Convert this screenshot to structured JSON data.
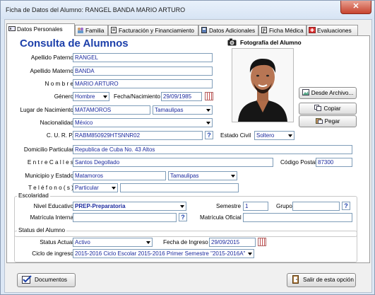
{
  "window": {
    "title": "Ficha de Datos del Alumno: RANGEL BANDA MARIO ARTURO",
    "close_label": "✕"
  },
  "tabs": [
    {
      "label": "Datos Personales",
      "icon": "id-card-icon"
    },
    {
      "label": "Familia",
      "icon": "family-icon"
    },
    {
      "label": "Facturación y Financiamiento",
      "icon": "invoice-icon"
    },
    {
      "label": "Datos Adicionales",
      "icon": "notebook-icon"
    },
    {
      "label": "Ficha Médica",
      "icon": "medical-record-icon"
    },
    {
      "label": "Evaluaciones",
      "icon": "evaluations-icon"
    }
  ],
  "heading": "Consulta de Alumnos",
  "photo": {
    "label": "Fotografía del Alumno",
    "from_file_label": "Desde Archivo...",
    "copy_label": "Copiar",
    "paste_label": "Pegar"
  },
  "labels": {
    "apellido_paterno": "Apellido Paterno",
    "apellido_materno": "Apellido Materno",
    "nombre": "N o m b r e",
    "genero": "Género",
    "fecha_nacimiento": "Fecha/Nacimiento",
    "lugar_nacimiento": "Lugar de Nacimiento",
    "nacionalidad": "Nacionalidad",
    "curp": "C. U. R. P.",
    "estado_civil": "Estado Civil",
    "domicilio": "Domicilio Particular",
    "calles": "E n t r e  C a l l e s",
    "codigo_postal": "Código Postal",
    "municipio": "Municipio y Estado",
    "telefono": "T e l é f o n o  ( s )",
    "escolaridad": "Escolaridad",
    "nivel": "Nivel Educativo",
    "semestre": "Semestre",
    "grupo": "Grupo",
    "matricula_interna": "Matrícula Interna",
    "matricula_oficial": "Matrícula Oficial",
    "status_group": "Status del Alumno",
    "status_actual": "Status Actual",
    "fecha_ingreso": "Fecha de Ingreso",
    "ciclo": "Ciclo de ingreso"
  },
  "values": {
    "apellido_paterno": "RANGEL",
    "apellido_materno": "BANDA",
    "nombre": "MARIO ARTURO",
    "genero": "Hombre",
    "fecha_nacimiento": "29/09/1985",
    "lugar_nacimiento": "MATAMOROS",
    "lugar_estado": "Tamaulipas",
    "nacionalidad": "México",
    "curp": "RABM850929HTSNNR02",
    "estado_civil": "Soltero",
    "domicilio": "Republica de Cuba No. 43 Altos",
    "calles": "Santos Degollado",
    "codigo_postal": "87300",
    "municipio": "Matamoros",
    "municipio_estado": "Tamaulipas",
    "telefono_tipo": "Particular",
    "telefono": "",
    "nivel": "PREP-Preparatoria",
    "semestre": "1",
    "grupo": "",
    "matricula_interna": "",
    "matricula_oficial": "",
    "status_actual": "Activo",
    "fecha_ingreso": "29/09/2015",
    "ciclo": "2015-2016 Ciclo Escolar 2015-2016 Primer Semestre \"2015-2016A\""
  },
  "buttons": {
    "documentos": "Documentos",
    "salir": "Salir de esta opción"
  },
  "colors": {
    "heading": "#1c3faa",
    "field_text": "#1b2a9e",
    "window_frame": "#dce7f5"
  }
}
